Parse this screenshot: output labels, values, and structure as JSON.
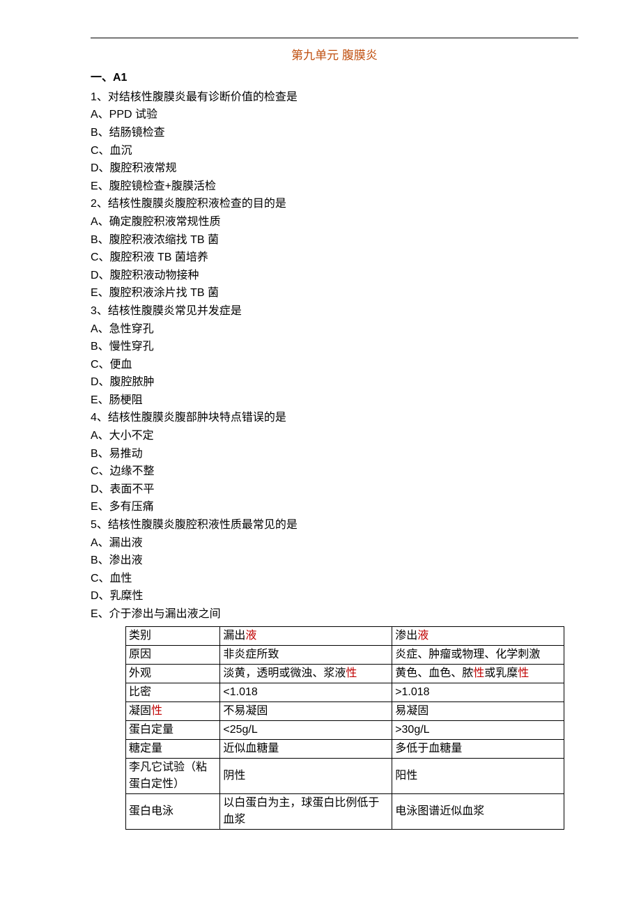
{
  "title": "第九单元 腹膜炎",
  "section_heading": "一、A1",
  "questions": [
    {
      "stem": "1、对结核性腹膜炎最有诊断价值的检查是",
      "options": [
        "A、PPD 试验",
        "B、结肠镜检查",
        "C、血沉",
        "D、腹腔积液常规",
        "E、腹腔镜检查+腹膜活检"
      ]
    },
    {
      "stem": "2、结核性腹膜炎腹腔积液检查的目的是",
      "options": [
        "A、确定腹腔积液常规性质",
        "B、腹腔积液浓缩找 TB 菌",
        "C、腹腔积液 TB 菌培养",
        "D、腹腔积液动物接种",
        "E、腹腔积液涂片找 TB 菌"
      ]
    },
    {
      "stem": "3、结核性腹膜炎常见并发症是",
      "options": [
        "A、急性穿孔",
        "B、慢性穿孔",
        "C、便血",
        "D、腹腔脓肿",
        "E、肠梗阻"
      ]
    },
    {
      "stem": "4、结核性腹膜炎腹部肿块特点错误的是",
      "options": [
        "A、大小不定",
        "B、易推动",
        "C、边缘不整",
        "D、表面不平",
        "E、多有压痛"
      ]
    },
    {
      "stem": "5、结核性腹膜炎腹腔积液性质最常见的是",
      "options": [
        "A、漏出液",
        "B、渗出液",
        "C、血性",
        "D、乳糜性",
        "E、介于渗出与漏出液之间"
      ]
    }
  ],
  "table": {
    "rows": [
      {
        "c1": {
          "pre": "类别",
          "hl": "",
          "post": ""
        },
        "c2": {
          "pre": "漏出",
          "hl": "液",
          "post": ""
        },
        "c3": {
          "pre": "渗出",
          "hl": "液",
          "post": ""
        }
      },
      {
        "c1": {
          "pre": "原因",
          "hl": "",
          "post": ""
        },
        "c2": {
          "pre": "非炎症所致",
          "hl": "",
          "post": ""
        },
        "c3": {
          "pre": "炎症、肿瘤或物理、化学刺激",
          "hl": "",
          "post": ""
        }
      },
      {
        "c1": {
          "pre": "外观",
          "hl": "",
          "post": ""
        },
        "c2": {
          "pre": "淡黄，透明或微浊、浆液",
          "hl": "性",
          "post": ""
        },
        "c3": {
          "pre": "黄色、血色、脓",
          "hl": "性",
          "post": "或乳糜",
          "hl2": "性"
        }
      },
      {
        "c1": {
          "pre": "比密",
          "hl": "",
          "post": ""
        },
        "c2": {
          "pre": "<1.018",
          "hl": "",
          "post": ""
        },
        "c3": {
          "pre": ">1.018",
          "hl": "",
          "post": ""
        }
      },
      {
        "c1": {
          "pre": "凝固",
          "hl": "性",
          "post": ""
        },
        "c2": {
          "pre": "不易凝固",
          "hl": "",
          "post": ""
        },
        "c3": {
          "pre": "易凝固",
          "hl": "",
          "post": ""
        }
      },
      {
        "c1": {
          "pre": "蛋白定量",
          "hl": "",
          "post": ""
        },
        "c2": {
          "pre": "<25g/L",
          "hl": "",
          "post": ""
        },
        "c3": {
          "pre": ">30g/L",
          "hl": "",
          "post": ""
        }
      },
      {
        "c1": {
          "pre": "糖定量",
          "hl": "",
          "post": ""
        },
        "c2": {
          "pre": "近似血糖量",
          "hl": "",
          "post": ""
        },
        "c3": {
          "pre": "多低于血糖量",
          "hl": "",
          "post": ""
        }
      },
      {
        "c1": {
          "pre": "李凡它试验（粘蛋白定性）",
          "hl": "",
          "post": ""
        },
        "c2": {
          "pre": "阴性",
          "hl": "",
          "post": ""
        },
        "c3": {
          "pre": "阳性",
          "hl": "",
          "post": ""
        }
      },
      {
        "c1": {
          "pre": "蛋白电泳",
          "hl": "",
          "post": ""
        },
        "c2": {
          "pre": "以白蛋白为主，球蛋白比例低于血浆",
          "hl": "",
          "post": ""
        },
        "c3": {
          "pre": "电泳图谱近似血浆",
          "hl": "",
          "post": ""
        }
      }
    ]
  }
}
